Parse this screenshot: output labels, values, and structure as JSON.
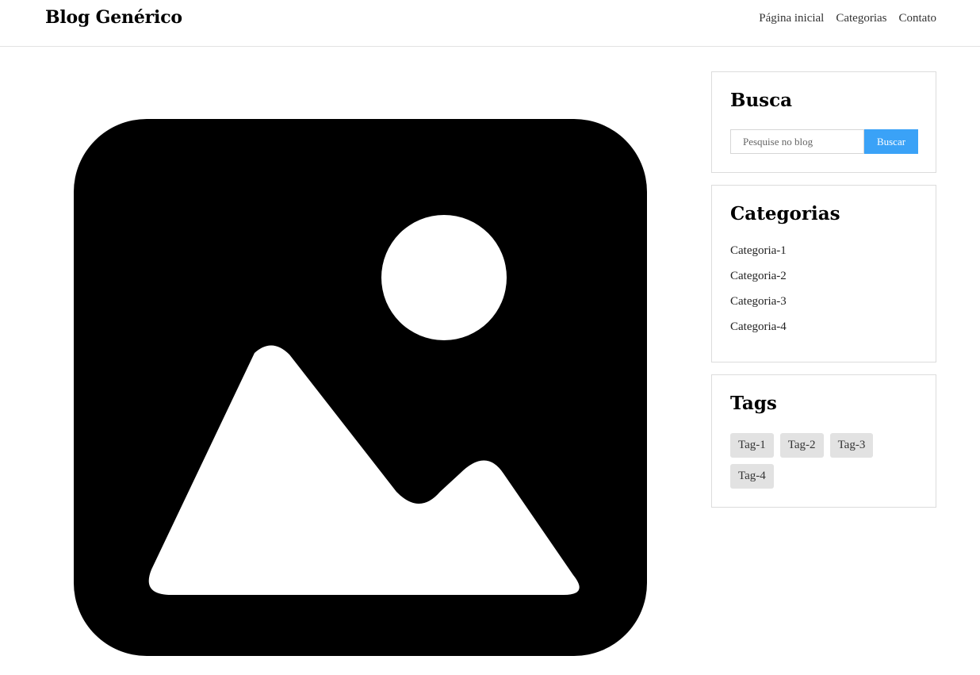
{
  "header": {
    "brand": "Blog Genérico",
    "nav": [
      {
        "label": "Página inicial"
      },
      {
        "label": "Categorias"
      },
      {
        "label": "Contato"
      }
    ]
  },
  "main": {
    "hero_icon": "image-placeholder-icon"
  },
  "sidebar": {
    "search": {
      "title": "Busca",
      "placeholder": "Pesquise no blog",
      "button_label": "Buscar",
      "button_color": "#3aa2f7"
    },
    "categories": {
      "title": "Categorias",
      "items": [
        {
          "label": "Categoria-1"
        },
        {
          "label": "Categoria-2"
        },
        {
          "label": "Categoria-3"
        },
        {
          "label": "Categoria-4"
        }
      ]
    },
    "tags": {
      "title": "Tags",
      "items": [
        {
          "label": "Tag-1"
        },
        {
          "label": "Tag-2"
        },
        {
          "label": "Tag-3"
        },
        {
          "label": "Tag-4"
        }
      ]
    }
  }
}
